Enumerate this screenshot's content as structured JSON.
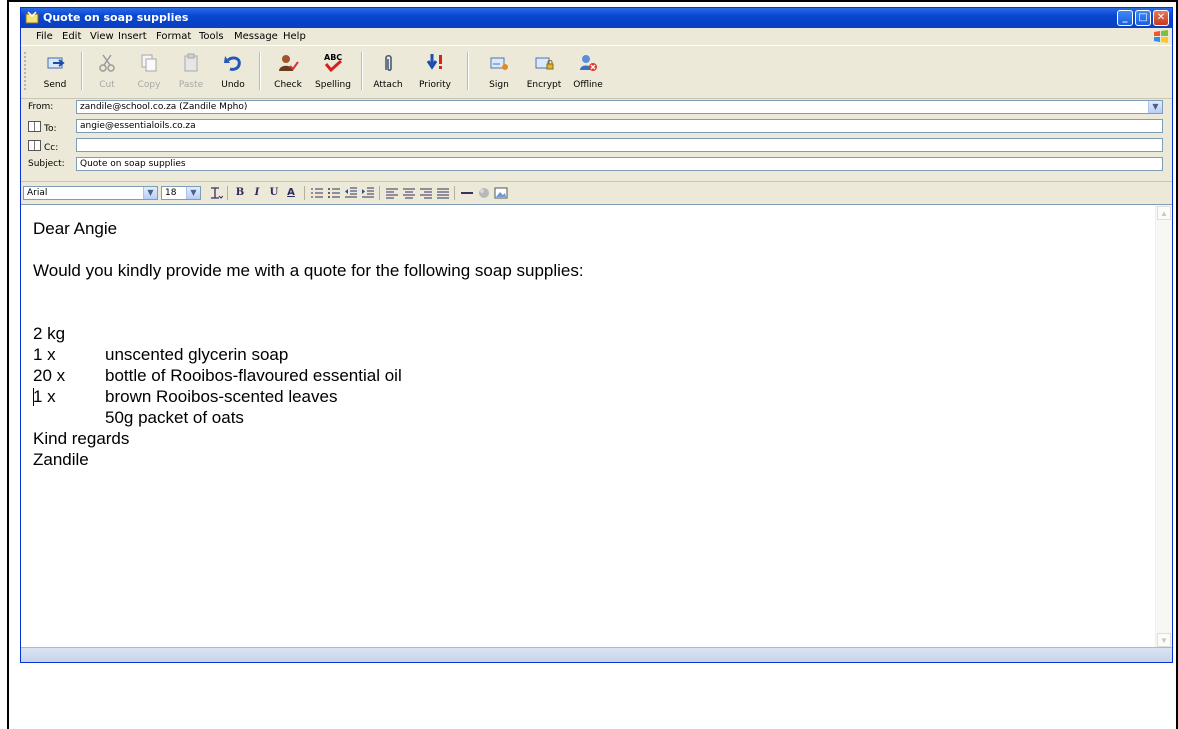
{
  "window": {
    "title": "Quote on soap supplies"
  },
  "menu": [
    "File",
    "Edit",
    "View",
    "Insert",
    "Format",
    "Tools",
    "Message",
    "Help"
  ],
  "toolbar": {
    "send": "Send",
    "cut": "Cut",
    "copy": "Copy",
    "paste": "Paste",
    "undo": "Undo",
    "check": "Check",
    "spelling": "Spelling",
    "attach": "Attach",
    "priority": "Priority",
    "sign": "Sign",
    "encrypt": "Encrypt",
    "offline": "Offline"
  },
  "header": {
    "from_label": "From:",
    "from_value": "zandile@school.co.za   (Zandile Mpho)",
    "to_label": "To:",
    "to_value": "angie@essentialoils.co.za",
    "cc_label": "Cc:",
    "cc_value": "",
    "subject_label": "Subject:",
    "subject_value": "Quote on soap supplies"
  },
  "format": {
    "font": "Arial",
    "size": "18",
    "bold": "B",
    "italic": "I",
    "underline": "U",
    "font_color": "A"
  },
  "message": {
    "greeting": "Dear Angie",
    "request": "Would you kindly provide me with a quote for the following soap supplies:",
    "items": [
      {
        "qty": "2 kg",
        "desc": "unscented glycerin soap"
      },
      {
        "qty": "1 x",
        "desc": "bottle of Rooibos-flavoured essential oil"
      },
      {
        "qty": "20 x",
        "desc": "brown Rooibos-scented leaves"
      },
      {
        "qty": "1 x",
        "desc": "50g packet of oats"
      }
    ],
    "closing": "Kind regards",
    "signature": "Zandile"
  }
}
